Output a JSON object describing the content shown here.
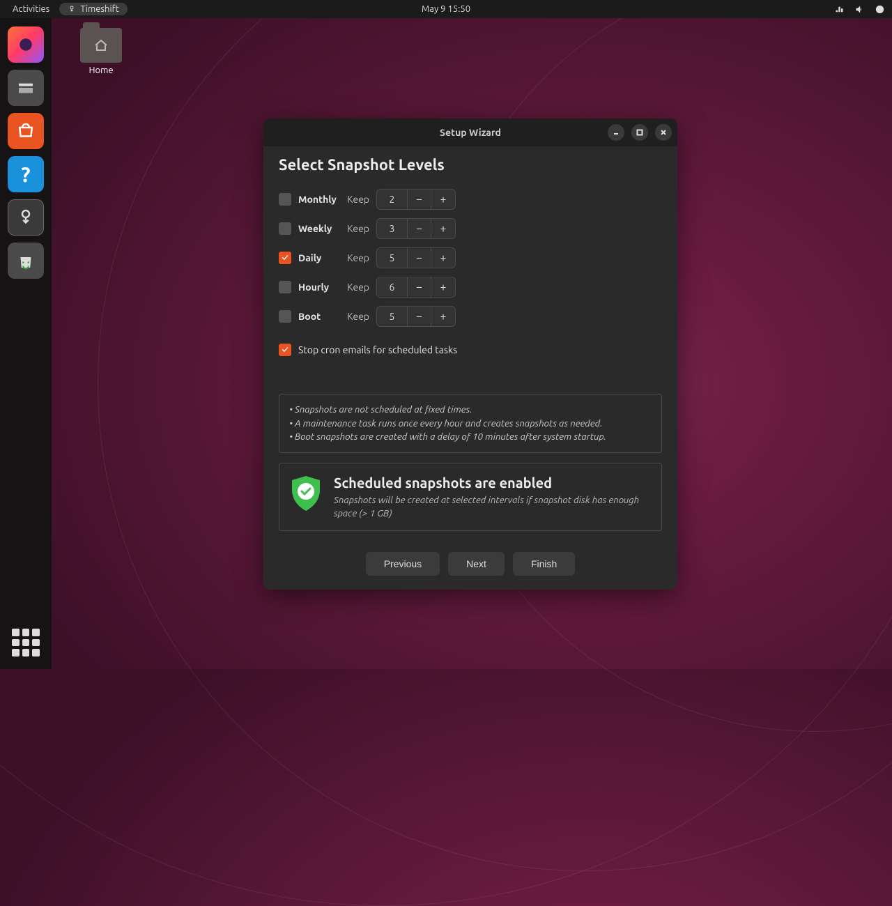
{
  "topbar": {
    "activities": "Activities",
    "app_name": "Timeshift",
    "clock": "May 9  15:50"
  },
  "desktop": {
    "home_label": "Home"
  },
  "dialog": {
    "title": "Setup Wizard",
    "heading": "Select Snapshot Levels",
    "levels": [
      {
        "name": "Monthly",
        "checked": false,
        "keep_label": "Keep",
        "value": "2"
      },
      {
        "name": "Weekly",
        "checked": false,
        "keep_label": "Keep",
        "value": "3"
      },
      {
        "name": "Daily",
        "checked": true,
        "keep_label": "Keep",
        "value": "5"
      },
      {
        "name": "Hourly",
        "checked": false,
        "keep_label": "Keep",
        "value": "6"
      },
      {
        "name": "Boot",
        "checked": false,
        "keep_label": "Keep",
        "value": "5"
      }
    ],
    "cron": {
      "checked": true,
      "label": "Stop cron emails for scheduled tasks"
    },
    "info": [
      "Snapshots are not scheduled at fixed times.",
      "A maintenance task runs once every hour and creates snapshots as needed.",
      "Boot snapshots are created with a delay of 10 minutes after system startup."
    ],
    "status": {
      "title": "Scheduled snapshots are enabled",
      "subtitle": "Snapshots will be created at selected intervals if snapshot disk has enough space (> 1 GB)"
    },
    "buttons": {
      "previous": "Previous",
      "next": "Next",
      "finish": "Finish"
    }
  }
}
